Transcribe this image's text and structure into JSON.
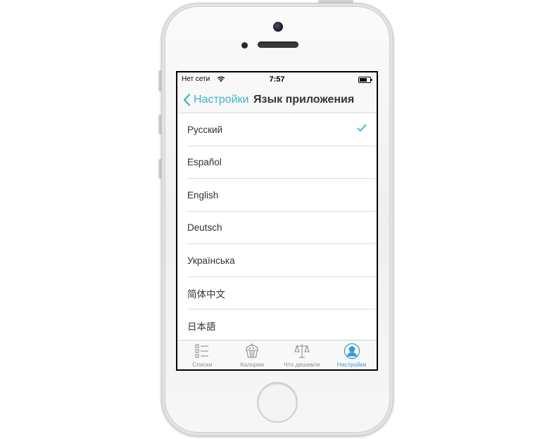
{
  "status_bar": {
    "carrier": "Нет сети",
    "time": "7:57",
    "wifi_icon": "wifi-icon",
    "battery_icon": "battery-icon"
  },
  "nav_bar": {
    "back_label": "Настройки",
    "title": "Язык приложения",
    "accent_color": "#3cb6c2"
  },
  "languages": {
    "items": [
      {
        "label": "Русский",
        "selected": true
      },
      {
        "label": "Español",
        "selected": false
      },
      {
        "label": "English",
        "selected": false
      },
      {
        "label": "Deutsch",
        "selected": false
      },
      {
        "label": "Українська",
        "selected": false
      },
      {
        "label": "简体中文",
        "selected": false
      },
      {
        "label": "日本語",
        "selected": false
      }
    ]
  },
  "tab_bar": {
    "active_color": "#3a98d8",
    "inactive_color": "#8e8e8e",
    "tabs": [
      {
        "label": "Списки",
        "icon": "list-icon",
        "active": false
      },
      {
        "label": "Калории",
        "icon": "muffin-icon",
        "active": false
      },
      {
        "label": "Что дешевле",
        "icon": "scales-icon",
        "active": false
      },
      {
        "label": "Настройки",
        "icon": "user-icon",
        "active": true
      }
    ]
  }
}
